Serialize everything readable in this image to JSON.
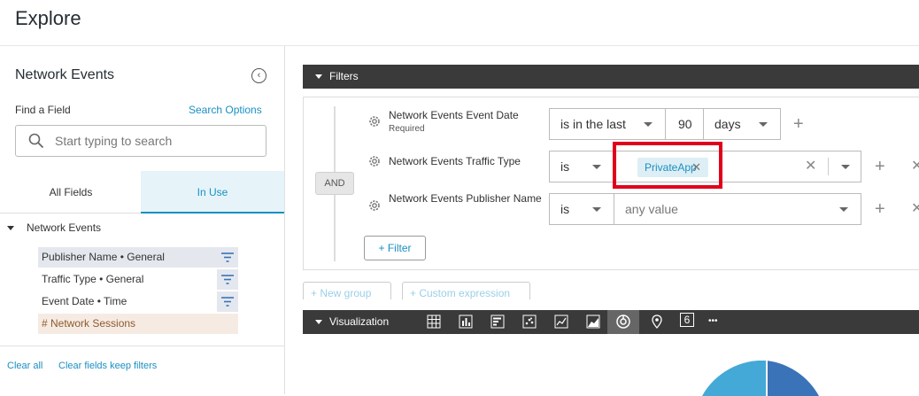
{
  "header": {
    "title": "Explore"
  },
  "sidebar": {
    "explore_name": "Network Events",
    "find_label": "Find a Field",
    "search_options": "Search Options",
    "search_placeholder": "Start typing to search",
    "tabs": [
      "All Fields",
      "In Use"
    ],
    "group": "Network Events",
    "fields": [
      {
        "label": "Publisher Name • General",
        "filtered": true,
        "selected": true
      },
      {
        "label": "Traffic Type • General",
        "filtered": true,
        "selected": false
      },
      {
        "label": "Event Date • Time",
        "filtered": true,
        "selected": false
      },
      {
        "label": "# Network Sessions",
        "type": "measure"
      }
    ],
    "clear_all": "Clear all",
    "clear_keep": "Clear fields keep filters"
  },
  "filters": {
    "bar_title": "Filters",
    "and_label": "AND",
    "rows": [
      {
        "label": "Network Events Event Date",
        "sub": "Required",
        "operator": "is in the last",
        "value": "90",
        "unit": "days"
      },
      {
        "label": "Network Events Traffic Type",
        "operator": "is",
        "chip": "PrivateApp"
      },
      {
        "label": "Network Events Publisher Name",
        "operator": "is",
        "placeholder": "any value"
      }
    ],
    "add_filter": "Filter",
    "new_group": "New group",
    "custom_expression": "Custom expression"
  },
  "visualization": {
    "bar_title": "Visualization",
    "icons": [
      "table-icon",
      "column-chart-icon",
      "bar-chart-icon",
      "scatter-icon",
      "line-chart-icon",
      "area-chart-icon",
      "pie-chart-icon",
      "map-pin-icon",
      "single-value-icon",
      "more-icon"
    ],
    "single_value_glyph": "6",
    "more_glyph": "•••",
    "active": "pie-chart-icon"
  },
  "colors": {
    "accent": "#1a8fc2",
    "highlight": "#e1001b",
    "bar": "#3a3a3a",
    "donut_a": "#3b73b9",
    "donut_b": "#44a9d6"
  }
}
